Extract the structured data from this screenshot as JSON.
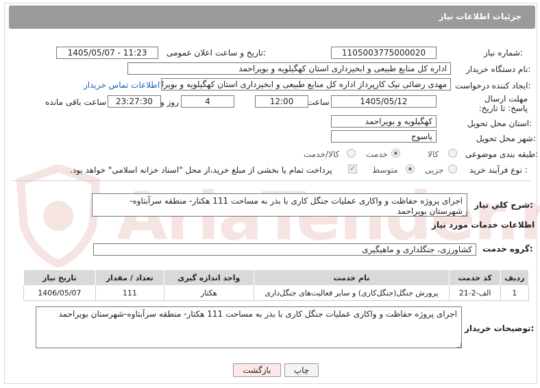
{
  "header": {
    "title": "جزئیات اطلاعات نیاز"
  },
  "form": {
    "need_number_label": "شماره نیاز:",
    "need_number": "1105003775000020",
    "announce_label": "تاریخ و ساعت اعلان عمومی:",
    "announce_value": "1405/05/07 - 11:23",
    "buyer_org_label": "نام دستگاه خریدار:",
    "buyer_org": "اداره کل منابع طبیعی و ابخیزداری استان کهگیلویه و بویراحمد",
    "creator_label": "ایجاد کننده درخواست:",
    "creator": "مهدی رضائی نیک کارپرداز اداره کل منابع طبیعی و ابخیزداری استان کهگیلویه و بویراحمد",
    "contact_link": "اطلاعات تماس خریدار",
    "deadline_label": "مهلت ارسال پاسخ: تا تاریخ:",
    "deadline_date": "1405/05/12",
    "time_label": "ساعت",
    "deadline_time": "12:00",
    "days_value": "4",
    "days_label": "روز و",
    "remaining_time": "23:27:30",
    "remaining_label": "ساعت باقی مانده",
    "province_label": "استان محل تحویل:",
    "province": "کهگیلویه و بویراحمد",
    "city_label": "شهر محل تحویل:",
    "city": "یاسوج",
    "category_label": "طبقه بندی موضوعی:",
    "category_options": [
      "کالا",
      "خدمت",
      "کالا/خدمت"
    ],
    "category_selected": "خدمت",
    "process_label": "نوع فرآیند خرید :",
    "process_options": [
      "جزیی",
      "متوسط"
    ],
    "process_selected": "متوسط",
    "payment_note": "پرداخت تمام یا بخشی از مبلغ خرید،از محل \"اسناد خزانه اسلامی\" خواهد بود."
  },
  "summary": {
    "label": "شرح کلي نياز:",
    "text": "اجرای پروژه حفاظت و واکاری عملیات جنگل کاری با بذر به مساحت 111 هکتار- منطقه سرآبتاوه-شهرستان بویراحمد"
  },
  "services": {
    "section_title": "اطلاعات خدمات مورد نياز",
    "group_label": "گروه خدمت:",
    "group_value": "کشاورزی، جنگلداری و ماهیگیری",
    "columns": [
      "ردیف",
      "کد خدمت",
      "نام خدمت",
      "واحد اندازه گیری",
      "تعداد / مقدار",
      "تاریخ نیاز"
    ],
    "rows": [
      [
        "1",
        "الف-2-21",
        "پرورش جنگل(جنگل‌کاری) و سایر فعالیت‌های جنگل‌داری",
        "هکتار",
        "111",
        "1406/05/07"
      ]
    ]
  },
  "buyer_notes": {
    "label": "توضیحات خریدار:",
    "text": "اجرای پروژه حفاظت و واکاری عملیات جنگل کاری با بذر به مساحت 111 هکتار- منطقه سرآبتاوه-شهرستان بویراحمد"
  },
  "buttons": {
    "print": "چاپ",
    "back": "بازگشت"
  },
  "watermark": {
    "text": "AriaTender.net"
  },
  "colors": {
    "header_bg": "#9a9a9a",
    "link": "#1a5fb4",
    "back_button_bg": "#fde8e8"
  }
}
